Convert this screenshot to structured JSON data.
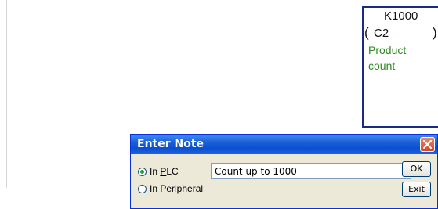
{
  "coil": {
    "constant": "K1000",
    "open_bracket": "(",
    "close_bracket": ")",
    "address": "C2",
    "comment_line1": "Product",
    "comment_line2": "count"
  },
  "dialog": {
    "title": "Enter Note",
    "radio_plc_prefix": "In ",
    "radio_plc_mnemonic": "P",
    "radio_plc_suffix": "LC",
    "radio_peripheral_prefix": "In Perip",
    "radio_peripheral_mnemonic": "h",
    "radio_peripheral_suffix": "eral",
    "selected_option": "In PLC",
    "note_value": "Count up to 1000",
    "ok_label": "OK",
    "exit_label": "Exit"
  },
  "colors": {
    "comment": "#2e8b22",
    "coil_border": "#1b2a86",
    "titlebar": "#0a4fd1"
  }
}
